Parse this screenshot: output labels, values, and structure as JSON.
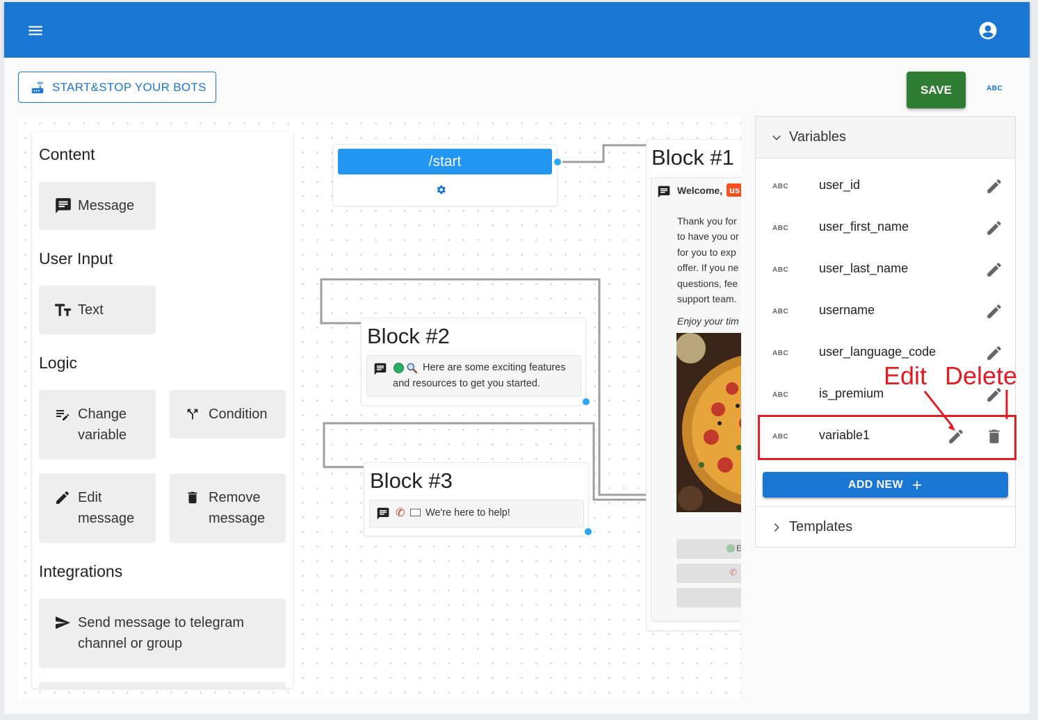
{
  "appbar": {
    "menu_icon": "menu-icon",
    "account_icon": "account-circle-icon",
    "color": "#1976d2"
  },
  "toolbar": {
    "startstop_label": "START&STOP YOUR BOTS",
    "save_label": "SAVE",
    "abc_label": "ABC",
    "save_color": "#2e7d32"
  },
  "palette": {
    "content_heading": "Content",
    "message_label": "Message",
    "user_input_heading": "User Input",
    "text_label": "Text",
    "logic_heading": "Logic",
    "change_variable_label_1": "Change",
    "change_variable_label_2": "variable",
    "condition_label": "Condition",
    "edit_message_label_1": "Edit",
    "edit_message_label_2": "message",
    "remove_message_label_1": "Remove",
    "remove_message_label_2": "message",
    "integrations_heading": "Integrations",
    "send_telegram_label_1": "Send message to telegram",
    "send_telegram_label_2": "channel or group"
  },
  "flow": {
    "start_label": "/start",
    "block1": {
      "title": "Block #1",
      "header": "Welcome,",
      "tag": "us",
      "body_lines": [
        "Thank you for",
        "to have you or",
        "for you to exp",
        "offer. If you ne",
        "questions, fee",
        "support team."
      ],
      "italic": "Enjoy your tim",
      "button1": "E"
    },
    "block2": {
      "title": "Block #2",
      "text_1": "Here are some exciting features",
      "text_2": "and resources to get you started."
    },
    "block3": {
      "title": "Block #3",
      "text": "We're here to help!"
    }
  },
  "variables_panel": {
    "header": "Variables",
    "abc": "ABC",
    "items": [
      {
        "name": "user_id"
      },
      {
        "name": "user_first_name"
      },
      {
        "name": "user_last_name"
      },
      {
        "name": "username"
      },
      {
        "name": "user_language_code"
      },
      {
        "name": "is_premium"
      },
      {
        "name": "variable1"
      }
    ],
    "add_new_label": "ADD NEW",
    "templates_header": "Templates"
  },
  "annotations": {
    "edit": "Edit",
    "delete": "Delete",
    "color": "#e31b23"
  }
}
